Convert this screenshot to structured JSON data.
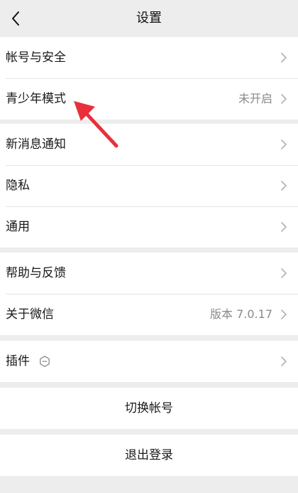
{
  "header": {
    "title": "设置",
    "back_icon": "chevron-left-icon"
  },
  "groups": {
    "account": {
      "items": [
        {
          "label": "帐号与安全",
          "value": ""
        },
        {
          "label": "青少年模式",
          "value": "未开启"
        }
      ]
    },
    "general": {
      "items": [
        {
          "label": "新消息通知",
          "value": ""
        },
        {
          "label": "隐私",
          "value": ""
        },
        {
          "label": "通用",
          "value": ""
        }
      ]
    },
    "about": {
      "items": [
        {
          "label": "帮助与反馈",
          "value": ""
        },
        {
          "label": "关于微信",
          "value": "版本 7.0.17"
        }
      ]
    },
    "plugins": {
      "items": [
        {
          "label": "插件",
          "value": "",
          "icon": "plugin-hexagon-icon"
        }
      ]
    }
  },
  "actions": {
    "switch_account": "切换帐号",
    "logout": "退出登录"
  },
  "colors": {
    "background": "#ededed",
    "card": "#ffffff",
    "secondary_text": "#8a8a8a",
    "annotation_arrow": "#e8303a"
  }
}
